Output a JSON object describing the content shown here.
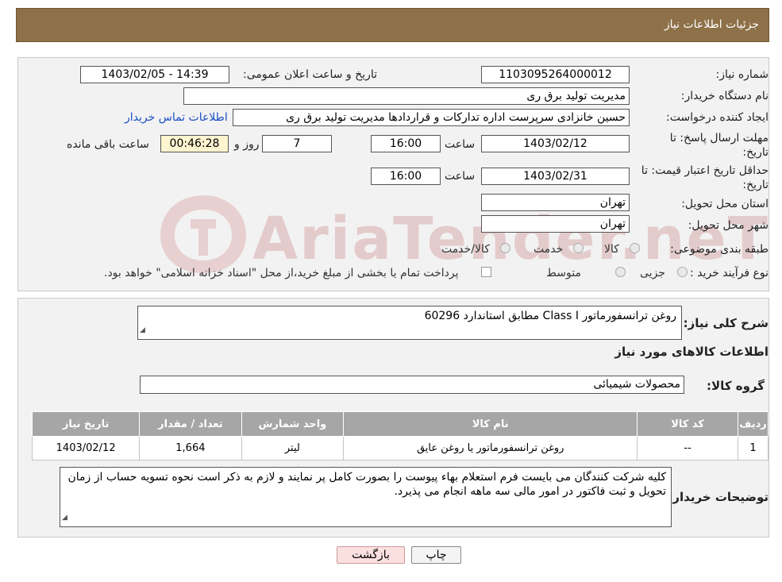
{
  "header": {
    "title": "جزئیات اطلاعات نیاز"
  },
  "watermark": "AriaTender.neT",
  "form": {
    "need_number_label": "شماره نیاز:",
    "need_number": "1103095264000012",
    "announce_label": "تاریخ و ساعت اعلان عمومی:",
    "announce_value": "1403/02/05 - 14:39",
    "buyer_org_label": "نام دستگاه خریدار:",
    "buyer_org": "مدیریت تولید برق ری",
    "creator_label": "ایجاد کننده درخواست:",
    "creator": "حسین خانزادی سرپرست اداره تدارکات و قراردادها مدیریت تولید برق ری",
    "contact_link": "اطلاعات تماس خریدار",
    "deadline_label": "مهلت ارسال پاسخ: تا تاریخ:",
    "deadline_date": "1403/02/12",
    "time_label": "ساعت",
    "deadline_time": "16:00",
    "days_count": "7",
    "days_label": "روز و",
    "remaining_time": "00:46:28",
    "remaining_label": "ساعت باقی مانده",
    "validity_label": "حداقل تاریخ اعتبار قیمت: تا تاریخ:",
    "validity_date": "1403/02/31",
    "validity_time": "16:00",
    "province_label": "استان محل تحویل:",
    "province": "تهران",
    "city_label": "شهر محل تحویل:",
    "city": "تهران",
    "category_label": "طبقه بندی موضوعی:",
    "category_options": [
      "کالا",
      "خدمت",
      "کالا/خدمت"
    ],
    "process_label": "نوع فرآیند خرید :",
    "process_options": [
      "جزیی",
      "متوسط"
    ],
    "process_note": "پرداخت تمام یا بخشی از مبلغ خرید،از محل \"اسناد خزانه اسلامی\" خواهد بود."
  },
  "details": {
    "summary_label": "شرح کلی نیاز:",
    "summary": "روغن ترانسفورماتور  Class I مطابق استاندارد 60296",
    "goods_title": "اطلاعات کالاهای مورد نیاز",
    "group_label": "گروه کالا:",
    "group_value": "محصولات شیمیائی",
    "table": {
      "headers": [
        "ردیف",
        "کد کالا",
        "نام کالا",
        "واحد شمارش",
        "تعداد / مقدار",
        "تاریخ نیاز"
      ],
      "rows": [
        [
          "1",
          "--",
          "روغن ترانسفورماتور یا روغن عایق",
          "لیتر",
          "1,664",
          "1403/02/12"
        ]
      ]
    },
    "buyer_notes_label": "توضیحات خریدار:",
    "buyer_notes": "کلیه شرکت کنندگان می بایست فرم استعلام بهاء پیوست را بصورت کامل پر نمایند و لازم به ذکر است نحوه تسویه حساب از زمان تحویل و ثبت فاکتور در امور مالی سه ماهه انجام می پذیرد."
  },
  "buttons": {
    "print": "چاپ",
    "back": "بازگشت"
  },
  "colors": {
    "header_bg": "#8e7148",
    "table_header_bg": "#a6a6a6",
    "link": "#1a4fc4"
  }
}
